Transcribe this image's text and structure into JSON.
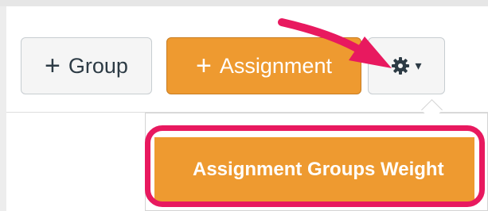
{
  "toolbar": {
    "group_button_label": "Group",
    "assignment_button_label": "Assignment",
    "plus_glyph": "+",
    "settings_caret": "▾"
  },
  "settings_menu": {
    "items": [
      {
        "label": "Assignment Groups Weight",
        "state": "highlighted"
      }
    ]
  },
  "annotation": {
    "highlight_color": "#e8195f",
    "arrow_color": "#e8195f"
  },
  "colors": {
    "accent": "#ee9a30",
    "button_bg": "#f5f5f5",
    "text": "#2d3b45"
  },
  "icons": [
    "plus-icon",
    "gear-icon",
    "caret-down-icon"
  ]
}
